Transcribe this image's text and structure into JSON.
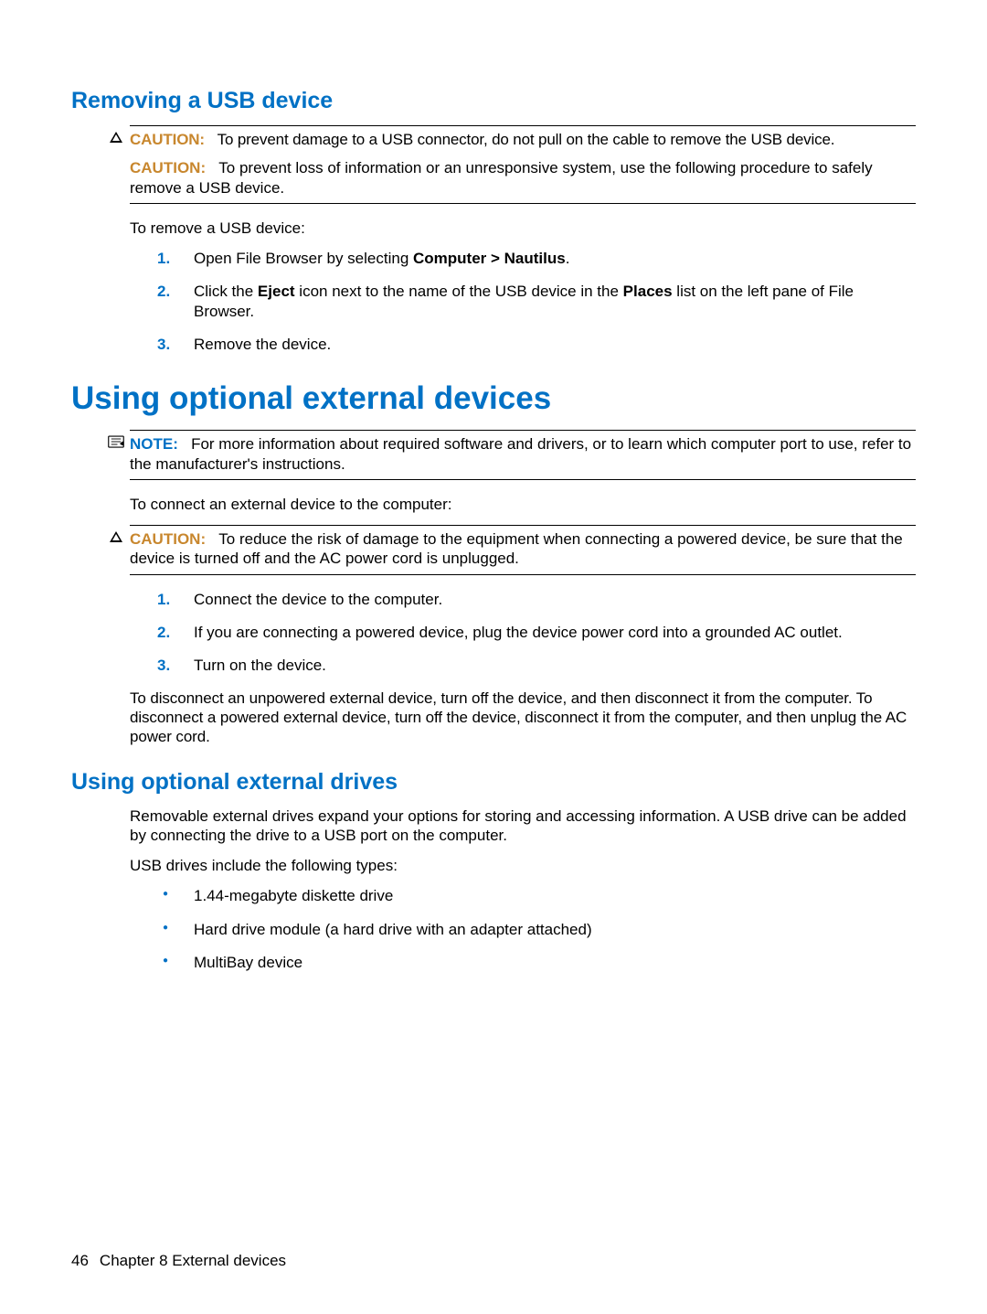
{
  "section1": {
    "heading": "Removing a USB device",
    "caution1": {
      "label": "CAUTION:",
      "text": "To prevent damage to a USB connector, do not pull on the cable to remove the USB device."
    },
    "caution2": {
      "label": "CAUTION:",
      "text": "To prevent loss of information or an unresponsive system, use the following procedure to safely remove a USB device."
    },
    "intro": "To remove a USB device:",
    "steps": {
      "s1_a": "Open File Browser by selecting ",
      "s1_b": "Computer > Nautilus",
      "s1_c": ".",
      "s2_a": "Click the ",
      "s2_b": "Eject",
      "s2_c": " icon next to the name of the USB device in the ",
      "s2_d": "Places",
      "s2_e": " list on the left pane of File Browser.",
      "s3": "Remove the device."
    }
  },
  "section2": {
    "heading": "Using optional external devices",
    "note": {
      "label": "NOTE:",
      "text": "For more information about required software and drivers, or to learn which computer port to use, refer to the manufacturer's instructions."
    },
    "intro": "To connect an external device to the computer:",
    "caution": {
      "label": "CAUTION:",
      "text": "To reduce the risk of damage to the equipment when connecting a powered device, be sure that the device is turned off and the AC power cord is unplugged."
    },
    "steps": {
      "s1": "Connect the device to the computer.",
      "s2": "If you are connecting a powered device, plug the device power cord into a grounded AC outlet.",
      "s3": "Turn on the device."
    },
    "outro": "To disconnect an unpowered external device, turn off the device, and then disconnect it from the computer. To disconnect a powered external device, turn off the device, disconnect it from the computer, and then unplug the AC power cord."
  },
  "section3": {
    "heading": "Using optional external drives",
    "p1": "Removable external drives expand your options for storing and accessing information. A USB drive can be added by connecting the drive to a USB port on the computer.",
    "p2": "USB drives include the following types:",
    "bullets": {
      "b1": "1.44-megabyte diskette drive",
      "b2": "Hard drive module (a hard drive with an adapter attached)",
      "b3": "MultiBay device"
    }
  },
  "footer": {
    "page": "46",
    "chapter": "Chapter 8   External devices"
  }
}
